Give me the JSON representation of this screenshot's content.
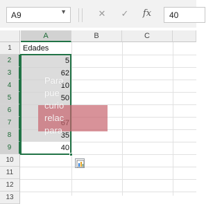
{
  "formula_bar": {
    "name_box": "A9",
    "cancel_symbol": "✕",
    "enter_symbol": "✓",
    "fx_label": "fx",
    "formula_value": "40"
  },
  "grid": {
    "columns": [
      "A",
      "B",
      "C"
    ],
    "rows": [
      "1",
      "2",
      "3",
      "4",
      "5",
      "6",
      "7",
      "8",
      "9",
      "10",
      "11",
      "12",
      "13"
    ],
    "header_cell": "Edades",
    "values": [
      "5",
      "62",
      "10",
      "50",
      "",
      "67",
      "35",
      "40"
    ]
  },
  "overlay": {
    "text": "Para\npue\ncurio\nrelac\npara"
  },
  "colors": {
    "excel_green": "#217346",
    "selection_gray": "#d0d0d0",
    "overlay_band": "#c8646e"
  }
}
